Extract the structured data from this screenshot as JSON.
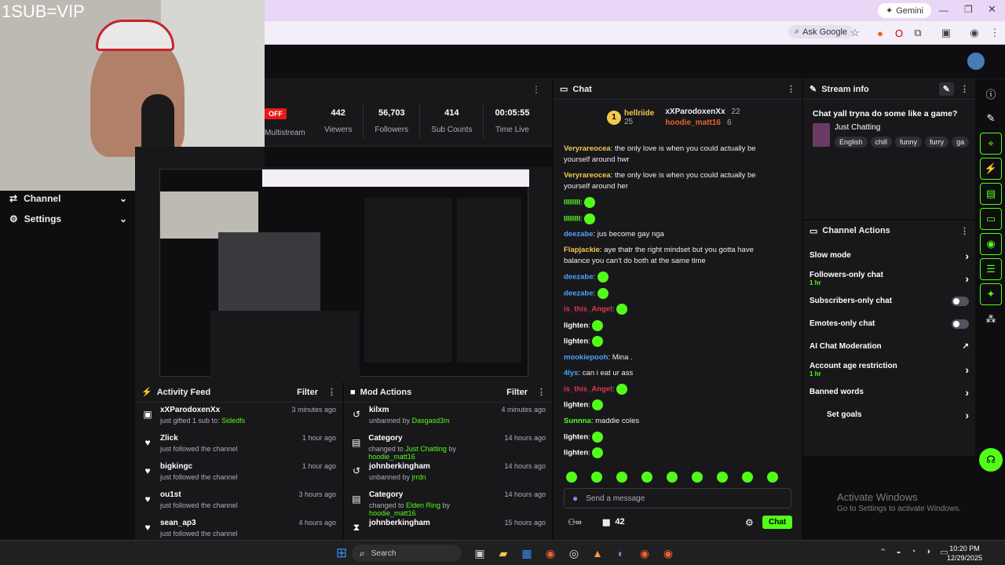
{
  "overlay": {
    "sub_text": "1SUB=VIP"
  },
  "browser": {
    "gemini_label": "Gemini",
    "ask_google": "Ask Google"
  },
  "stats": {
    "off_badge": "OFF",
    "multistream": "Multistream",
    "items": [
      {
        "value": "442",
        "label": "Viewers"
      },
      {
        "value": "56,703",
        "label": "Followers"
      },
      {
        "value": "414",
        "label": "Sub Counts"
      },
      {
        "value": "00:05:55",
        "label": "Time Live"
      }
    ]
  },
  "sidebar": {
    "channel": "Channel",
    "settings": "Settings"
  },
  "activity": {
    "title": "Activity Feed",
    "filter": "Filter",
    "rows": [
      {
        "name": "xXParodoxenXx",
        "sub": "just gifted",
        "sub2": "1 sub to:",
        "target": "Sidedfs",
        "time": "3 minutes ago",
        "icon": "gift-icon"
      },
      {
        "name": "Zlick",
        "sub": "just followed the channel",
        "time": "1 hour ago",
        "icon": "heart-icon"
      },
      {
        "name": "bigkingc",
        "sub": "just followed the channel",
        "time": "1 hour ago",
        "icon": "heart-icon"
      },
      {
        "name": "ou1st",
        "sub": "just followed the channel",
        "time": "3 hours ago",
        "icon": "heart-icon"
      },
      {
        "name": "sean_ap3",
        "sub": "just followed the channel",
        "time": "4 hours ago",
        "icon": "heart-icon"
      }
    ]
  },
  "mod": {
    "title": "Mod Actions",
    "filter": "Filter",
    "rows": [
      {
        "name": "kilxm",
        "sub": "unbanned by",
        "by": "Dasgasd3m",
        "time": "4 minutes ago",
        "icon": "unban-icon"
      },
      {
        "name": "Category",
        "sub": "changed to",
        "cat": "Just Chatting",
        "by2": "by",
        "by": "hoodie_matt16",
        "time": "14 hours ago",
        "icon": "category-icon"
      },
      {
        "name": "johnberkingham",
        "sub": "unbanned by",
        "by": "jrrdn",
        "time": "14 hours ago",
        "icon": "unban-icon"
      },
      {
        "name": "Category",
        "sub": "changed to",
        "cat": "Elden Ring",
        "by2": "by",
        "by": "hoodie_matt16",
        "time": "14 hours ago",
        "icon": "category-icon"
      },
      {
        "name": "johnberkingham",
        "sub": "",
        "by": "",
        "time": "15 hours ago",
        "icon": "timeout-icon"
      }
    ]
  },
  "chat": {
    "title": "Chat",
    "placeholder": "Send a message",
    "viewer_count": "42",
    "chat_button": "Chat",
    "top": [
      {
        "rank": "1",
        "name": "hellriide",
        "count": "25"
      },
      {
        "name": "xXParodoxenXx",
        "count": "22"
      },
      {
        "name": "hoodie_matt16",
        "count": "6"
      }
    ],
    "messages": [
      {
        "user": "Veryrareocea",
        "color": "#f2c94c",
        "text": "the only love is when you could actually be yourself around hwr"
      },
      {
        "user": "Veryrareocea",
        "color": "#f2c94c",
        "text": "the only love is when you could actually be yourself around her"
      },
      {
        "user": "IIIIIIII",
        "color": "#53fc18",
        "text": ""
      },
      {
        "user": "IIIIIIII",
        "color": "#53fc18",
        "text": ""
      },
      {
        "user": "deezabe",
        "color": "#4aa3ff",
        "text": "jus become gay nga"
      },
      {
        "user": "Flapjackie",
        "color": "#f2c94c",
        "text": "aye thatr the right mindset but you gotta have balance you can't do both at the same time"
      },
      {
        "user": "deezabe",
        "color": "#4aa3ff",
        "text": ""
      },
      {
        "user": "deezabe",
        "color": "#4aa3ff",
        "text": ""
      },
      {
        "user": "is_this_Angel",
        "color": "#e0364a",
        "text": ""
      },
      {
        "user": "lighten",
        "color": "#ffffff",
        "text": ""
      },
      {
        "user": "lighten",
        "color": "#ffffff",
        "text": ""
      },
      {
        "user": "mookiepooh",
        "color": "#4aa3ff",
        "text": "Mina ."
      },
      {
        "user": "4lys",
        "color": "#4aa3ff",
        "text": "can i eat ur ass"
      },
      {
        "user": "is_this_Angel",
        "color": "#e0364a",
        "text": ""
      },
      {
        "user": "lighten",
        "color": "#ffffff",
        "text": ""
      },
      {
        "user": "Sunnna",
        "color": "#53fc18",
        "text": "maddie coles"
      },
      {
        "user": "lighten",
        "color": "#ffffff",
        "text": ""
      },
      {
        "user": "lighten",
        "color": "#ffffff",
        "text": ""
      }
    ]
  },
  "stream_info": {
    "header": "Stream info",
    "title": "Chat yall tryna do some like a game?",
    "category": "Just Chatting",
    "tags": [
      "English",
      "chill",
      "funny",
      "furry",
      "ga"
    ]
  },
  "channel_actions": {
    "header": "Channel Actions",
    "rows": [
      {
        "label": "Slow mode",
        "kind": "chev"
      },
      {
        "label": "Followers-only chat",
        "sub": "1 hr",
        "kind": "chev"
      },
      {
        "label": "Subscribers-only chat",
        "kind": "toggle"
      },
      {
        "label": "Emotes-only chat",
        "kind": "toggle"
      },
      {
        "label": "AI Chat Moderation",
        "kind": "ext"
      },
      {
        "label": "Account age restriction",
        "sub": "1 hr",
        "kind": "chev"
      },
      {
        "label": "Banned words",
        "kind": "chev"
      },
      {
        "label": "Set goals",
        "kind": "chev"
      }
    ]
  },
  "windows": {
    "activate": "Activate Windows",
    "activate_sub": "Go to Settings to activate Windows.",
    "search": "Search",
    "time": "10:20 PM",
    "date": "12/29/2025"
  }
}
